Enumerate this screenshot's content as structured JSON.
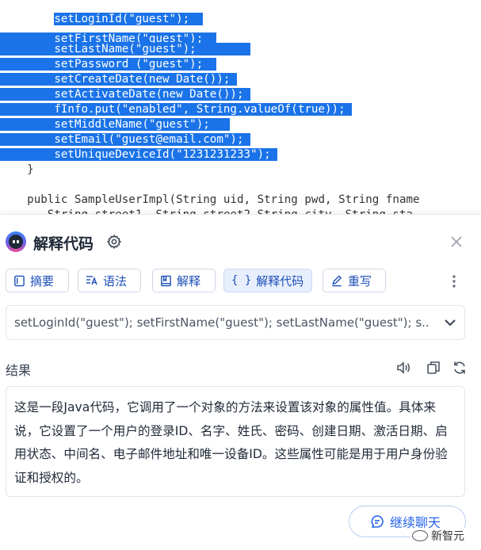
{
  "code": {
    "lines": [
      {
        "indent": "        ",
        "text": "setLoginId(\"guest\");"
      },
      {
        "indent": "        ",
        "text": "setFirstName(\"guest\");"
      },
      {
        "indent": "        ",
        "text": "setLastName(\"guest\");"
      },
      {
        "indent": "        ",
        "text": "setPassword (\"guest\");"
      },
      {
        "indent": "        ",
        "text": "setCreateDate(new Date());"
      },
      {
        "indent": "        ",
        "text": "setActivateDate(new Date());"
      },
      {
        "indent": "        ",
        "text": "fInfo.put(\"enabled\", String.valueOf(true));"
      },
      {
        "indent": "        ",
        "text": "setMiddleName(\"guest\");"
      },
      {
        "indent": "        ",
        "text": "setEmail(\"guest@email.com\");"
      },
      {
        "indent": "        ",
        "text": "setUniqueDeviceId(\"1231231233\");"
      },
      {
        "indent": "    ",
        "text": "}"
      },
      {
        "indent": "",
        "text": ""
      },
      {
        "indent": "    ",
        "text": "public SampleUserImpl(String uid, String pwd, String fname"
      },
      {
        "indent": "       ",
        "text": "String street1, String street2 String city, String sta"
      }
    ],
    "selection_color": "#1a73e8"
  },
  "panel": {
    "title": "解释代码",
    "tabs": [
      {
        "label": "摘要",
        "icon": "document-icon"
      },
      {
        "label": "语法",
        "icon": "grammar-icon"
      },
      {
        "label": "解释",
        "icon": "book-icon"
      },
      {
        "label": "解释代码",
        "icon": "braces-icon",
        "active": true
      },
      {
        "label": "重写",
        "icon": "pen-icon"
      }
    ],
    "input_value": "setLoginId(\"guest\"); setFirstName(\"guest\"); setLastName(\"guest\"); s...",
    "result_label": "结果",
    "result_text": "这是一段Java代码，它调用了一个对象的方法来设置该对象的属性值。具体来说，它设置了一个用户的登录ID、名字、姓氏、密码、创建日期、激活日期、启用状态、中间名、电子邮件地址和唯一设备ID。这些属性可能是用于用户身份验证和授权的。",
    "continue_label": "继续聊天",
    "accent_color": "#2563eb"
  },
  "watermark": {
    "text": "新智元"
  }
}
